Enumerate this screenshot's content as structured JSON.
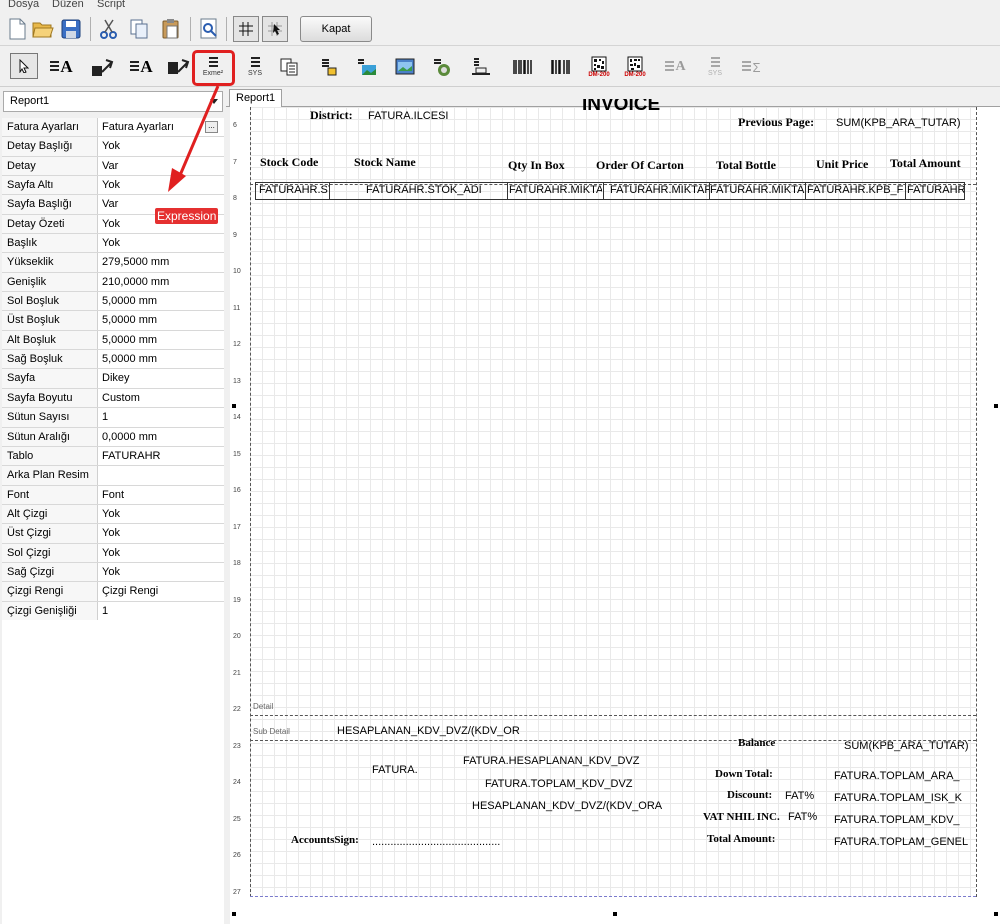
{
  "menu": [
    "Dosya",
    "Düzen",
    "Script"
  ],
  "toolbar": {
    "kapat_label": "Kapat",
    "icons": [
      "new-file-icon",
      "open-folder-icon",
      "save-icon",
      "cut-icon",
      "copy-icon",
      "paste-icon",
      "preview-icon",
      "grid-icon",
      "snap-icon"
    ]
  },
  "components": {
    "expr_sub": "Exme²",
    "sys_label": "SYS",
    "dm_label": "DM-200",
    "sys2_label": "SYS"
  },
  "report_combo": "Report1",
  "properties": [
    {
      "name": "Fatura Ayarları",
      "value": "Fatura Ayarları"
    },
    {
      "name": "Detay Başlığı",
      "value": "Yok"
    },
    {
      "name": "Detay",
      "value": "Var"
    },
    {
      "name": "Sayfa Altı",
      "value": "Yok"
    },
    {
      "name": "Sayfa Başlığı",
      "value": "Var"
    },
    {
      "name": "Detay Özeti",
      "value": "Yok"
    },
    {
      "name": "Başlık",
      "value": "Yok"
    },
    {
      "name": "Yükseklik",
      "value": "279,5000 mm"
    },
    {
      "name": "Genişlik",
      "value": "210,0000 mm"
    },
    {
      "name": "Sol Boşluk",
      "value": "5,0000 mm"
    },
    {
      "name": "Üst Boşluk",
      "value": "5,0000 mm"
    },
    {
      "name": "Alt Boşluk",
      "value": "5,0000 mm"
    },
    {
      "name": "Sağ Boşluk",
      "value": "5,0000 mm"
    },
    {
      "name": "Sayfa",
      "value": "Dikey"
    },
    {
      "name": "Sayfa Boyutu",
      "value": "Custom"
    },
    {
      "name": "Sütun Sayısı",
      "value": "1"
    },
    {
      "name": "Sütun Aralığı",
      "value": "0,0000 mm"
    },
    {
      "name": "Tablo",
      "value": "FATURAHR"
    },
    {
      "name": "Arka Plan Resim",
      "value": ""
    },
    {
      "name": "Font",
      "value": "Font"
    },
    {
      "name": "Alt Çizgi",
      "value": "Yok"
    },
    {
      "name": "Üst Çizgi",
      "value": "Yok"
    },
    {
      "name": "Sol Çizgi",
      "value": "Yok"
    },
    {
      "name": "Sağ Çizgi",
      "value": "Yok"
    },
    {
      "name": "Çizgi Rengi",
      "value": "Çizgi Rengi"
    },
    {
      "name": "Çizgi Genişliği",
      "value": "1"
    }
  ],
  "annotation": {
    "label": "Expression",
    "color": "#e53030"
  },
  "tab": "Report1",
  "ruler": [
    "6",
    "7",
    "8",
    "9",
    "10",
    "11",
    "12",
    "13",
    "14",
    "15",
    "16",
    "17",
    "18",
    "19",
    "20",
    "21",
    "22",
    "23",
    "24",
    "25",
    "26",
    "27"
  ],
  "bands": {
    "detail": "Detail",
    "sub_detail": "Sub Detail"
  },
  "header": {
    "title": "INVOICE",
    "district_label": "District:",
    "district_value": "FATURA.ILCESI",
    "previous_page_label": "Previous Page:",
    "previous_page_value": "SUM(KPB_ARA_TUTAR)"
  },
  "columns": [
    "Stock Code",
    "Stock Name",
    "Qty In Box",
    "Order Of Carton",
    "Total Bottle",
    "Unit Price",
    "Total Amount"
  ],
  "detail_cells": [
    "FATURAHR.ST",
    "FATURAHR.STOK_ADI",
    "FATURAHR.MIKTAR",
    "FATURAHR.MIKTARI",
    "FATURAHR.MIKTAR",
    "FATURAHR.KPB_FIY",
    "FATURAHR"
  ],
  "subdetail": {
    "hesap": "HESAPLANAN_KDV_DVZ/(KDV_OR",
    "fatura": "FATURA.",
    "hesap_kdv": "FATURA.HESAPLANAN_KDV_DVZ",
    "toplam_kdv": "FATURA.TOPLAM_KDV_DVZ",
    "hesap_ora": "HESAPLANAN_KDV_DVZ/(KDV_ORA",
    "accounts_sign": "AccountsSign:",
    "dots": "..........................................",
    "balance_label": "Balance",
    "balance_value": "SUM(KPB_ARA_TUTAR)",
    "down_total_label": "Down Total:",
    "down_total_value": "FATURA.TOPLAM_ARA_",
    "discount_label": "Discount:",
    "discount_pct": "FAT%",
    "discount_value": "FATURA.TOPLAM_ISK_K",
    "vat_label": "VAT NHIL INC.",
    "vat_pct": "FAT%",
    "vat_value": "FATURA.TOPLAM_KDV_",
    "total_label": "Total Amount:",
    "total_value": "FATURA.TOPLAM_GENEL"
  }
}
